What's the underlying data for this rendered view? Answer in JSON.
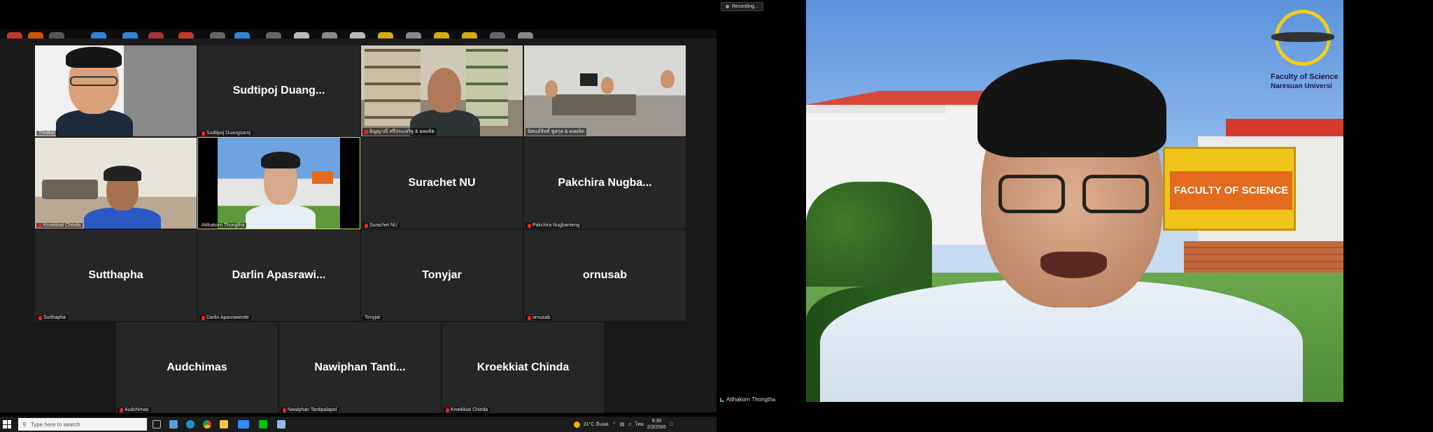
{
  "recording": {
    "label": "Recording..."
  },
  "gallery": {
    "tiles": [
      {
        "display": "",
        "label": "Thrdkat",
        "type": "video"
      },
      {
        "display": "Sudtipoj  Duang...",
        "label": "Sudtipoj Duangsaroj",
        "type": "name"
      },
      {
        "display": "",
        "label": "ธิญญาณี  ศรีประเสริฐ  & ผลผลิต",
        "type": "video"
      },
      {
        "display": "",
        "label": "นิพนธ์สิทธิ์ ชูสกุล & ผลผลิต",
        "type": "video"
      },
      {
        "display": "",
        "label": "Kroekkiat Chinda",
        "type": "video"
      },
      {
        "display": "",
        "label": "Atthakorn Thongtha",
        "type": "video"
      },
      {
        "display": "Surachet NU",
        "label": "Surachet NU",
        "type": "name"
      },
      {
        "display": "Pakchira Nugba...",
        "label": "Pakchira Nugbanteng",
        "type": "name"
      },
      {
        "display": "Sutthapha",
        "label": "Sutthapha",
        "type": "name"
      },
      {
        "display": "Darlin  Apasrawi...",
        "label": "Darlin Apasrawirote",
        "type": "name"
      },
      {
        "display": "Tonyjar",
        "label": "Tonyjar",
        "type": "name"
      },
      {
        "display": "ornusab",
        "label": "ornusab",
        "type": "name"
      },
      {
        "display": "Audchimas",
        "label": "Audchimas",
        "type": "name"
      },
      {
        "display": "Nawiphan  Tanti...",
        "label": "Nawiphan Tantipalapol",
        "type": "name"
      },
      {
        "display": "Kroekkiat  Chinda",
        "label": "Kroekkiat Chinda",
        "type": "name"
      }
    ]
  },
  "speaker": {
    "name": "Atthakorn Thongtha",
    "logo_line1": "Faculty of Science",
    "logo_line2": "Naresuan Universi",
    "sign_text": "FACULTY OF SCIENCE"
  },
  "taskbar": {
    "search_placeholder": "Type here to search",
    "weather": "31°C  มีแดด",
    "time": "9:30",
    "date": "2/3/2565",
    "lang": "ไทย"
  },
  "colors": {
    "accent": "#d4d46a",
    "mic_off": "#e22222",
    "tile_bg": "#262626"
  }
}
